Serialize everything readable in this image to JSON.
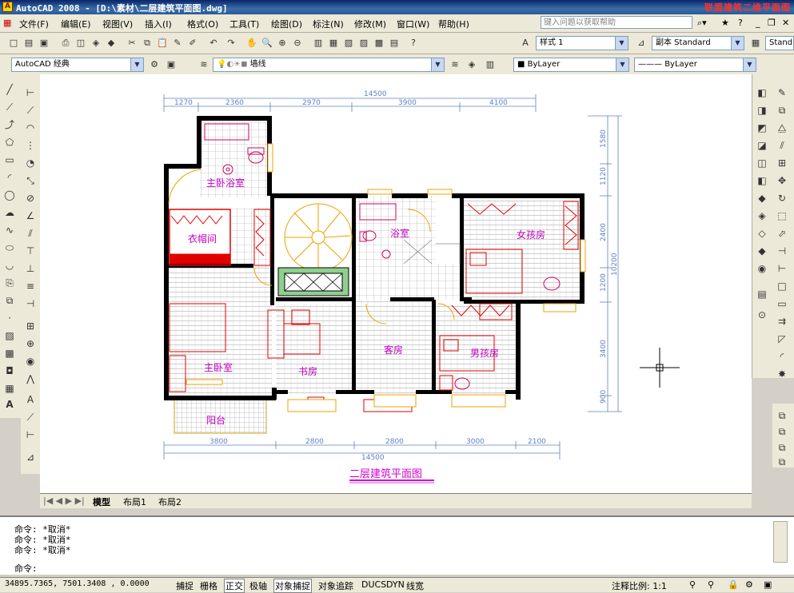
{
  "window": {
    "title": "AutoCAD 2008 - [D:\\素材\\二层建筑平面图.dwg]",
    "watermark": "联盟建筑二维平面图"
  },
  "menu": {
    "items": [
      "文件(F)",
      "编辑(E)",
      "视图(V)",
      "插入(I)",
      "格式(O)",
      "工具(T)",
      "绘图(D)",
      "标注(N)",
      "修改(M)",
      "窗口(W)",
      "帮助(H)"
    ],
    "help_search_placeholder": "键入问题以获取帮助"
  },
  "toolbar1": {
    "text_style": "样式 1",
    "dim_style": "副本 Standard",
    "table_style": "Stand"
  },
  "toolbar2": {
    "workspace": "AutoCAD 经典",
    "layer": "墙线",
    "color": "ByLayer",
    "linetype": "ByLayer"
  },
  "drawing": {
    "title": "二层建筑平面图",
    "top_dims": [
      "1270",
      "2360",
      "2970",
      "3900",
      "4100"
    ],
    "top_total": "14500",
    "bottom_dims": [
      "3800",
      "2800",
      "2800",
      "3000",
      "2100"
    ],
    "bottom_total": "14500",
    "right_dims": [
      "1580",
      "1120",
      "2400",
      "1200",
      "3400",
      "900"
    ],
    "right_total": "10200",
    "rooms": {
      "master_bath": "主卧浴室",
      "cloakroom": "衣帽间",
      "bath": "浴室",
      "girl_room": "女孩房",
      "master_bed": "主卧室",
      "study": "书房",
      "guest": "客房",
      "boy_room": "男孩房",
      "balcony": "阳台"
    }
  },
  "layout_tabs": [
    "模型",
    "布局1",
    "布局2"
  ],
  "command": {
    "history": [
      "命令: *取消*",
      "命令: *取消*",
      "命令: *取消*"
    ],
    "prompt": "命令:"
  },
  "status": {
    "coords": "34895.7365, 7501.3408 , 0.0000",
    "buttons": [
      "捕捉",
      "栅格",
      "正交",
      "极轴",
      "对象捕捉",
      "对象追踪",
      "DUCS",
      "DYN",
      "线宽"
    ],
    "scale": "注释比例: 1:1"
  }
}
